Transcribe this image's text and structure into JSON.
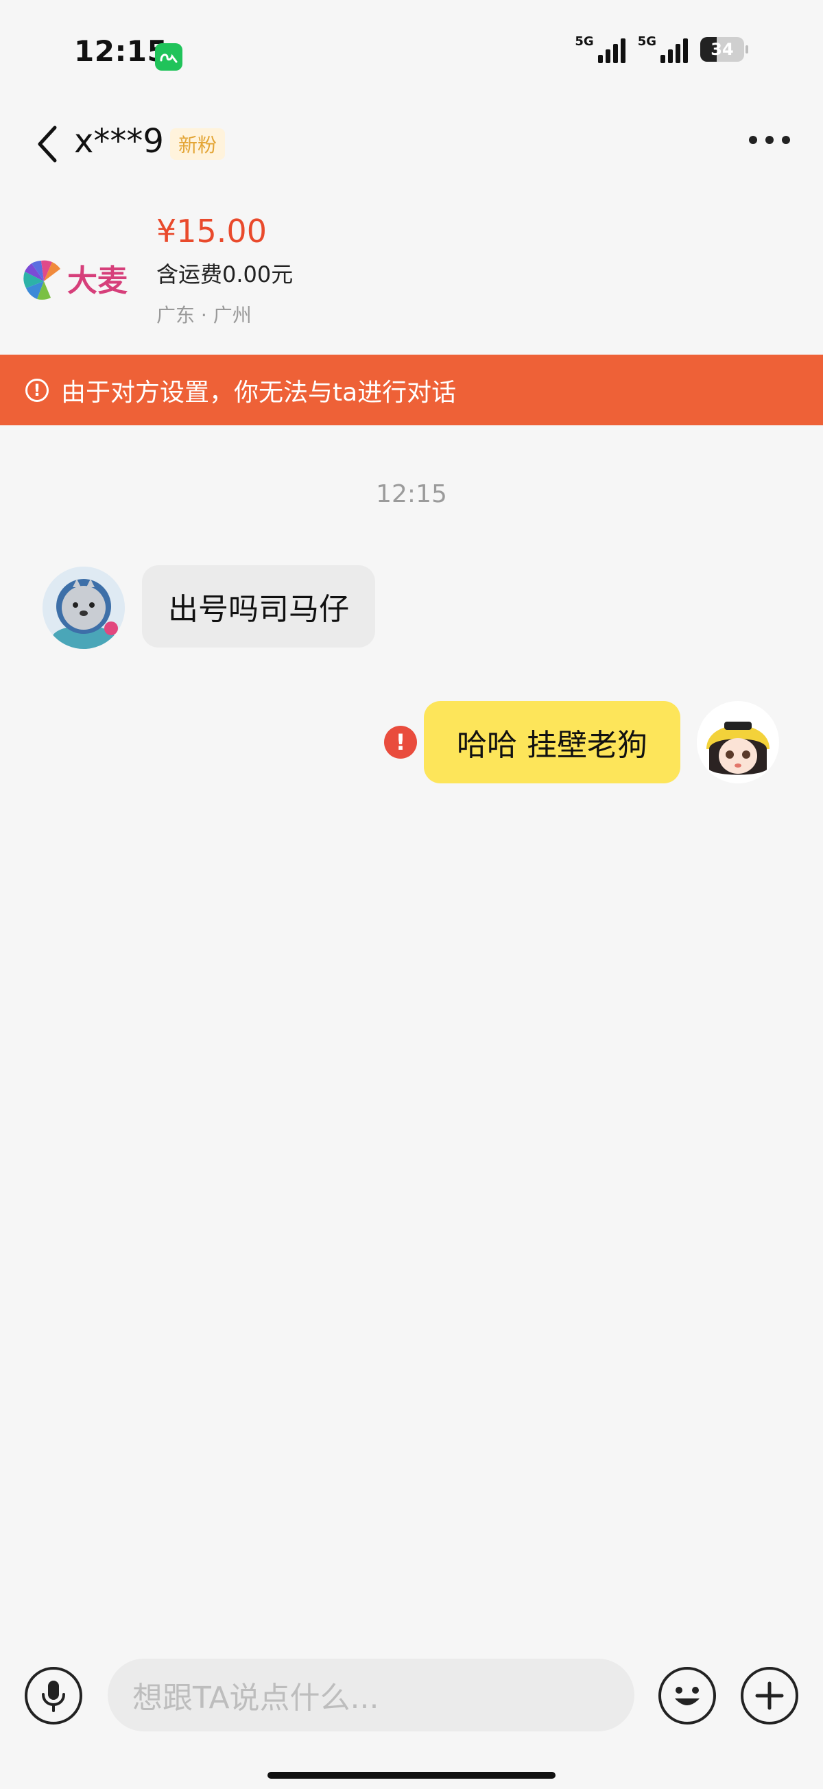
{
  "status_bar": {
    "time": "12:15",
    "signal_1_label": "5G",
    "signal_2_label": "5G",
    "battery": "34",
    "wechat_icon": "wechat-icon"
  },
  "header": {
    "title": "x***9",
    "badge": "新粉",
    "back_icon": "chevron-left-icon",
    "more_icon": "more-horizontal-icon"
  },
  "product": {
    "price": "¥15.00",
    "shipping": "含运费0.00元",
    "location": "广东 · 广州",
    "image_logo_text": "大麦"
  },
  "banner": {
    "text": "由于对方设置，你无法与ta进行对话",
    "icon": "info-circle-icon",
    "color": "#ee6137"
  },
  "chat": {
    "timestamp": "12:15",
    "messages": [
      {
        "side": "left",
        "text": "出号吗司马仔"
      },
      {
        "side": "right",
        "text": "哈哈 挂壁老狗",
        "status": "failed"
      }
    ]
  },
  "input_bar": {
    "placeholder": "想跟TA说点什么...",
    "mic_icon": "microphone-icon",
    "emoji_icon": "emoji-icon",
    "plus_icon": "plus-icon"
  },
  "colors": {
    "price": "#e94a2c",
    "right_bubble": "#fde55a",
    "left_bubble": "#ebebeb",
    "error": "#e94c3d",
    "badge_text": "#e3a535"
  }
}
